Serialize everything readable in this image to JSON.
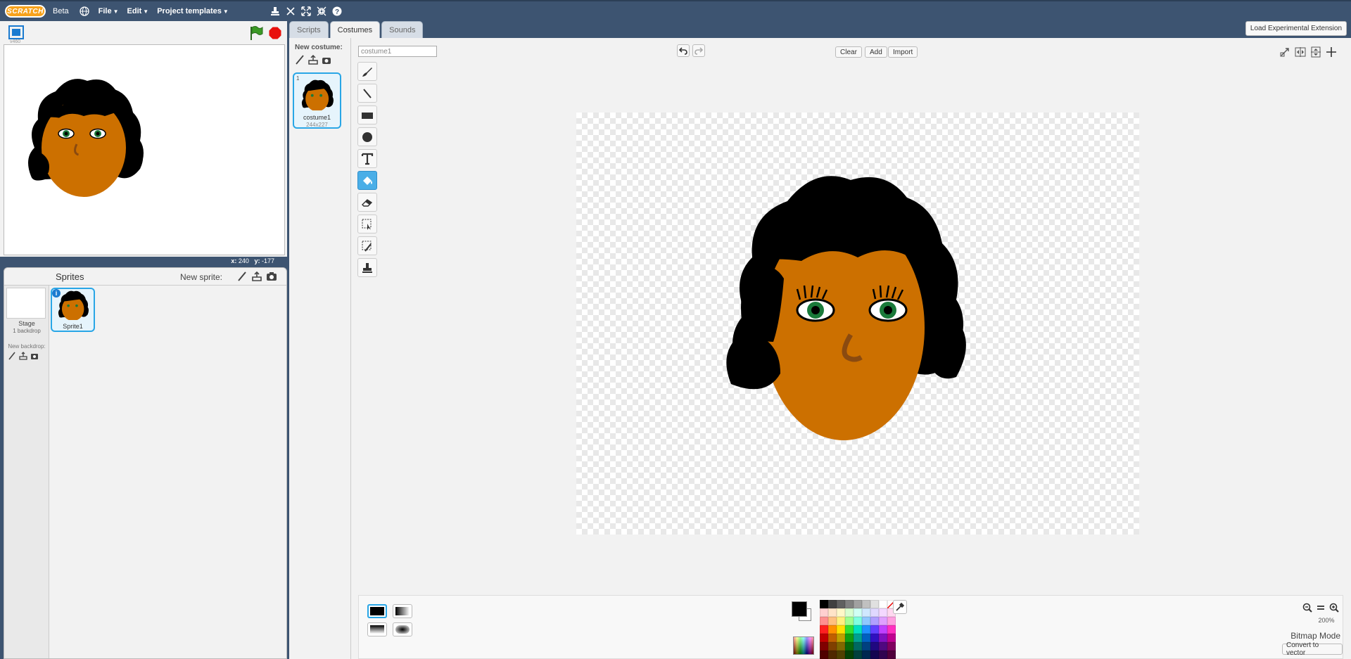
{
  "menubar": {
    "logo": "SCRATCH",
    "beta": "Beta",
    "file": "File",
    "edit": "Edit",
    "templates": "Project templates"
  },
  "stage": {
    "version": "v460",
    "mouse_x_label": "x:",
    "mouse_x": "240",
    "mouse_y_label": "y:",
    "mouse_y": "-177"
  },
  "sprites": {
    "header": "Sprites",
    "new_sprite": "New sprite:",
    "stage_label": "Stage",
    "backdrop_count": "1 backdrop",
    "new_backdrop": "New backdrop:",
    "items": [
      {
        "name": "Sprite1"
      }
    ]
  },
  "tabs": [
    {
      "label": "Scripts"
    },
    {
      "label": "Costumes"
    },
    {
      "label": "Sounds"
    }
  ],
  "experimental_label": "Load Experimental Extension",
  "costumes": {
    "new_costume": "New costume:",
    "items": [
      {
        "index": "1",
        "name": "costume1",
        "size": "244x227"
      }
    ]
  },
  "paint": {
    "costume_name": "costume1",
    "clear": "Clear",
    "add": "Add",
    "import": "Import",
    "zoom": "200%",
    "mode": "Bitmap Mode",
    "convert": "Convert to vector"
  },
  "colors": {
    "accent": "#29a6e6",
    "header": "#3d5471",
    "skin": "#cc7000",
    "hair": "#000000",
    "eye": "#1a7a3a"
  }
}
